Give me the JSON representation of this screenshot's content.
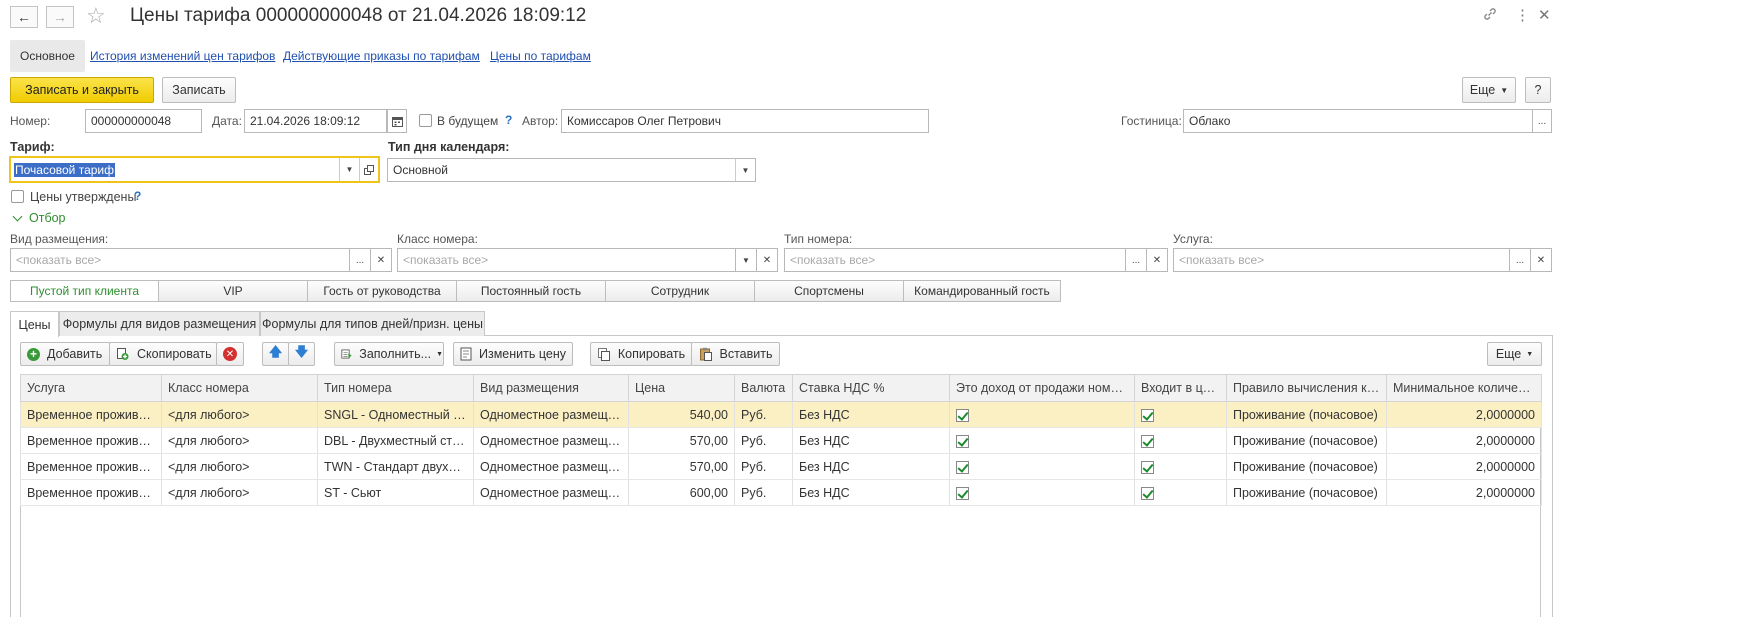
{
  "window": {
    "title": "Цены тарифа 000000000048 от 21.04.2026 18:09:12"
  },
  "nav": {
    "main": "Основное",
    "links": [
      "История изменений цен тарифов",
      "Действующие приказы по тарифам",
      "Цены по тарифам"
    ]
  },
  "toolbar": {
    "save_close": "Записать и закрыть",
    "save": "Записать",
    "more": "Еще",
    "help": "?"
  },
  "form": {
    "number_label": "Номер:",
    "number_value": "000000000048",
    "date_label": "Дата:",
    "date_value": "21.04.2026 18:09:12",
    "future_label": "В будущем",
    "future_help": "?",
    "author_label": "Автор:",
    "author_value": "Комиссаров Олег Петрович",
    "hotel_label": "Гостиница:",
    "hotel_value": "Облако",
    "tariff_label": "Тариф:",
    "tariff_value": "Почасовой тариф",
    "day_type_label": "Тип дня календаря:",
    "day_type_value": "Основной",
    "approved_label": "Цены утверждены",
    "approved_help": "?",
    "filter_toggle": "Отбор"
  },
  "filters": {
    "placeholder": "<показать все>",
    "accommodation_label": "Вид размещения:",
    "room_class_label": "Класс номера:",
    "room_type_label": "Тип номера:",
    "service_label": "Услуга:"
  },
  "client_tabs": [
    "Пустой тип клиента",
    "VIP",
    "Гость от руководства",
    "Постоянный гость",
    "Сотрудник",
    "Спортсмены",
    "Командированный гость"
  ],
  "page_tabs": [
    "Цены",
    "Формулы для видов размещения",
    "Формулы для типов дней/призн. цены"
  ],
  "grid_toolbar": {
    "add": "Добавить",
    "copy": "Скопировать",
    "fill": "Заполнить...",
    "change_price": "Изменить цену",
    "copy2": "Копировать",
    "paste": "Вставить",
    "more": "Еще"
  },
  "table": {
    "columns": [
      "Услуга",
      "Класс номера",
      "Тип номера",
      "Вид размещения",
      "Цена",
      "Валюта",
      "Ставка НДС %",
      "Это доход от продажи номеров",
      "Входит в цену",
      "Правило вычисления ко...",
      "Минимальное количество"
    ],
    "rows": [
      {
        "service": "Временное проживание",
        "room_class": "<для любого>",
        "room_type": "SNGL - Одноместный стандарт",
        "accommodation": "Одноместное размещение",
        "price": "540,00",
        "currency": "Руб.",
        "vat": "Без НДС",
        "is_room_income": true,
        "included": true,
        "rule": "Проживание (почасовое)",
        "min_qty": "2,0000000"
      },
      {
        "service": "Временное проживание",
        "room_class": "<для любого>",
        "room_type": "DBL - Двухместный стандарт",
        "accommodation": "Одноместное размещение",
        "price": "570,00",
        "currency": "Руб.",
        "vat": "Без НДС",
        "is_room_income": true,
        "included": true,
        "rule": "Проживание (почасовое)",
        "min_qty": "2,0000000"
      },
      {
        "service": "Временное проживание",
        "room_class": "<для любого>",
        "room_type": "TWN - Стандарт двухместный",
        "accommodation": "Одноместное размещение",
        "price": "570,00",
        "currency": "Руб.",
        "vat": "Без НДС",
        "is_room_income": true,
        "included": true,
        "rule": "Проживание (почасовое)",
        "min_qty": "2,0000000"
      },
      {
        "service": "Временное проживание",
        "room_class": "<для любого>",
        "room_type": "ST - Сьют",
        "accommodation": "Одноместное размещение",
        "price": "600,00",
        "currency": "Руб.",
        "vat": "Без НДС",
        "is_room_income": true,
        "included": true,
        "rule": "Проживание (почасовое)",
        "min_qty": "2,0000000"
      }
    ]
  },
  "colors": {
    "accent_yellow": "#f5d20f",
    "link_blue": "#2050b0",
    "selected_row": "#fbf0c4",
    "active_green": "#2f8f2f"
  }
}
